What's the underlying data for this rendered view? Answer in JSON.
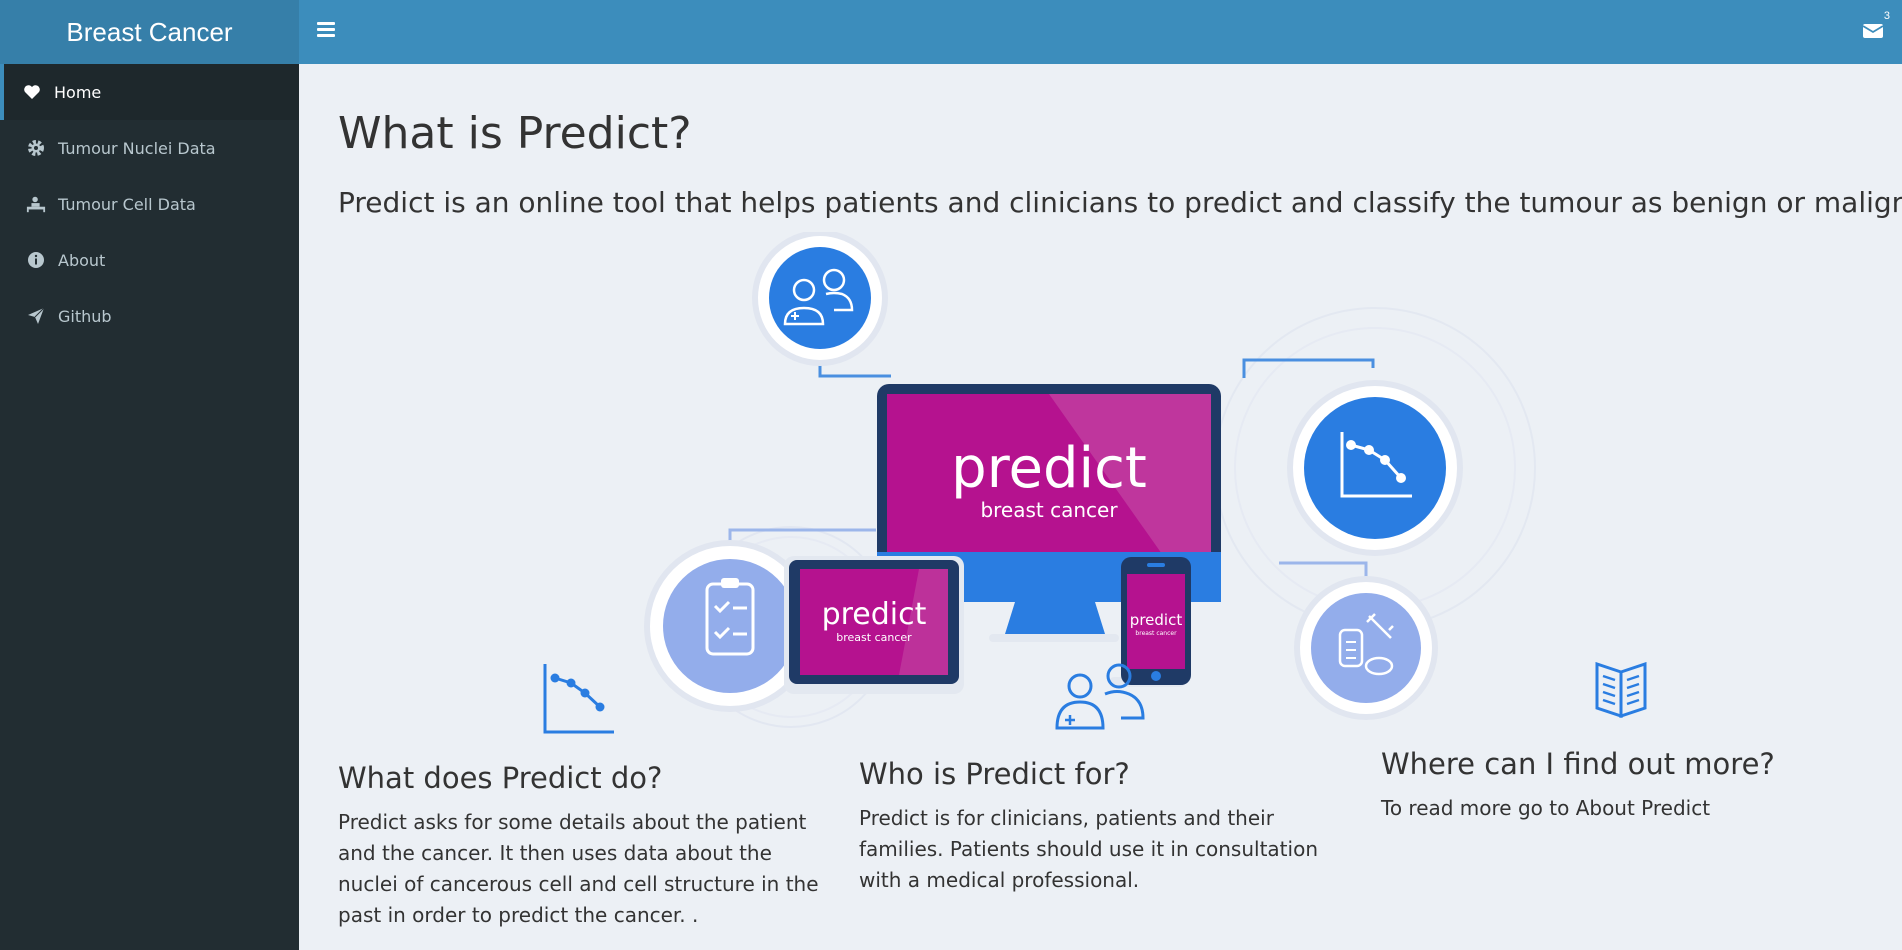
{
  "header": {
    "app_title": "Breast Cancer",
    "message_count": "3"
  },
  "sidebar": {
    "items": [
      {
        "label": "Home",
        "icon": "heart-icon"
      },
      {
        "label": "Tumour Nuclei Data",
        "icon": "gear-icon"
      },
      {
        "label": "Tumour Cell Data",
        "icon": "patient-bed-icon"
      },
      {
        "label": "About",
        "icon": "info-icon"
      },
      {
        "label": "Github",
        "icon": "paper-plane-icon"
      }
    ]
  },
  "main": {
    "title": "What is Predict?",
    "lead": "Predict is an online tool that helps patients and clinicians to predict and classify the tumour as benign or malignant.",
    "illustration": {
      "logo_main": "predict",
      "logo_sub": "breast cancer"
    },
    "columns": [
      {
        "icon": "line-chart-icon",
        "heading": "What does Predict do?",
        "text": "Predict asks for some details about the patient and the cancer. It then uses data about the nuclei of cancerous cell and cell structure in the past in order to predict the cancer. ."
      },
      {
        "icon": "users-icon",
        "heading": "Who is Predict for?",
        "text": "Predict is for clinicians, patients and their families. Patients should use it in consultation with a medical professional."
      },
      {
        "icon": "book-icon",
        "heading": "Where can I find out more?",
        "text": "To read more go to About Predict"
      }
    ]
  },
  "colors": {
    "header": "#3c8dbc",
    "logo_bg": "#367fa9",
    "sidebar": "#222d32",
    "magenta": "#b5128f",
    "blue": "#2a7de1"
  }
}
